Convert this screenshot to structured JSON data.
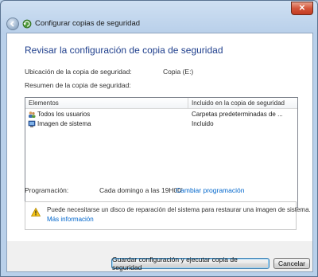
{
  "window": {
    "title": "Configurar copias de seguridad",
    "close_symbol": "✕"
  },
  "page": {
    "heading": "Revisar la configuración de copia de seguridad",
    "location_label": "Ubicación de la copia de seguridad:",
    "location_value": "Copia (E:)",
    "summary_label": "Resumen de la copia de seguridad:"
  },
  "table": {
    "columns": [
      "Elementos",
      "Incluido en la copia de seguridad"
    ],
    "rows": [
      {
        "name": "Todos los usuarios",
        "value": "Carpetas predeterminadas de ...",
        "icon": "users-icon"
      },
      {
        "name": "Imagen de sistema",
        "value": "Incluido",
        "icon": "system-image-icon"
      }
    ]
  },
  "schedule": {
    "label": "Programación:",
    "value": "Cada domingo a las 19H00'",
    "link": "Cambiar programación"
  },
  "info": {
    "text": "Puede necesitarse un disco de reparación del sistema para restaurar una imagen de sistema.",
    "link": "Más información",
    "icon": "warning-icon"
  },
  "buttons": {
    "save": "Guardar configuración y ejecutar copia de seguridad",
    "cancel": "Cancelar"
  },
  "colors": {
    "heading": "#1e3e8c",
    "link": "#0066cc"
  }
}
